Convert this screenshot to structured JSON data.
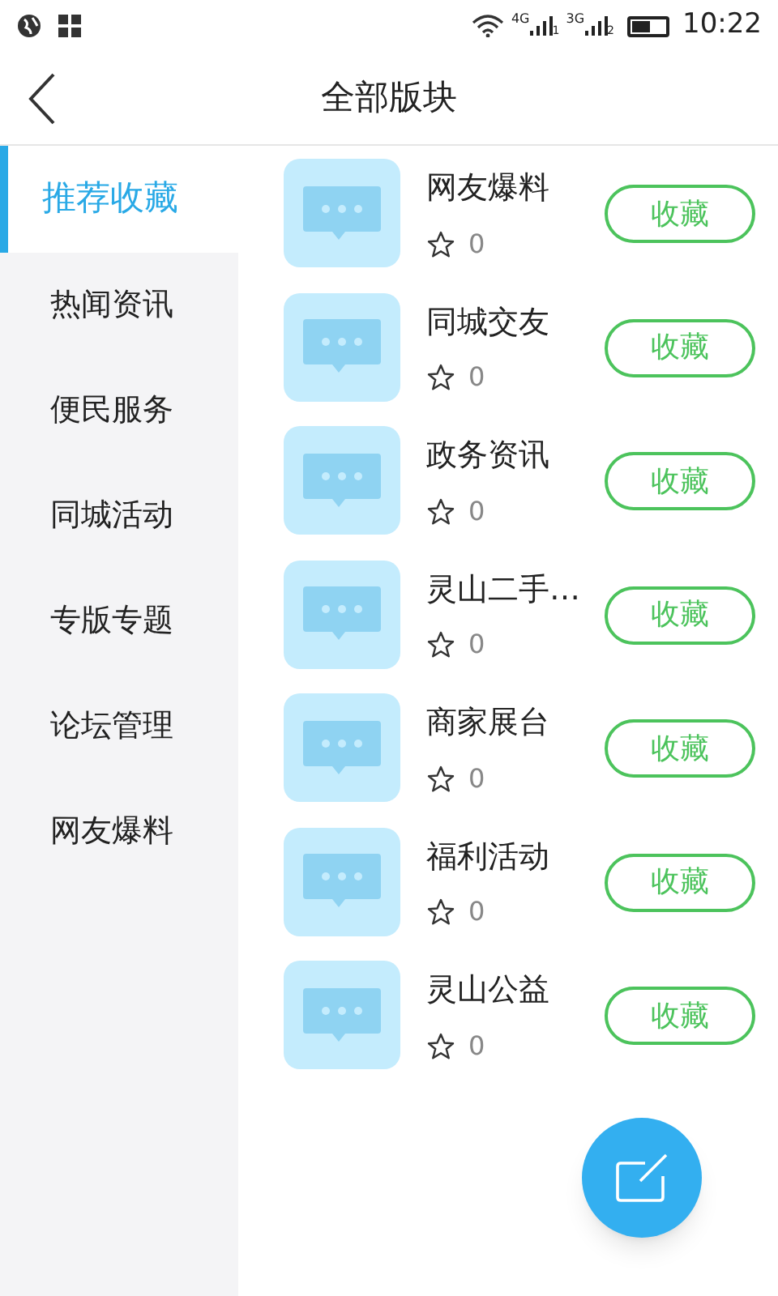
{
  "status_bar": {
    "network_1": "4G",
    "sim_1": "1",
    "network_2": "3G",
    "sim_2": "2",
    "time": "10:22"
  },
  "header": {
    "title": "全部版块"
  },
  "sidebar": {
    "items": [
      {
        "label": "推荐收藏",
        "selected": true
      },
      {
        "label": "热闻资讯",
        "selected": false
      },
      {
        "label": "便民服务",
        "selected": false
      },
      {
        "label": "同城活动",
        "selected": false
      },
      {
        "label": "专版专题",
        "selected": false
      },
      {
        "label": "论坛管理",
        "selected": false
      },
      {
        "label": "网友爆料",
        "selected": false
      }
    ]
  },
  "forums": [
    {
      "name": "网友爆料",
      "count": "0",
      "button": "收藏"
    },
    {
      "name": "同城交友",
      "count": "0",
      "button": "收藏"
    },
    {
      "name": "政务资讯",
      "count": "0",
      "button": "收藏"
    },
    {
      "name": "灵山二手…",
      "count": "0",
      "button": "收藏"
    },
    {
      "name": "商家展台",
      "count": "0",
      "button": "收藏"
    },
    {
      "name": "福利活动",
      "count": "0",
      "button": "收藏"
    },
    {
      "name": "灵山公益",
      "count": "0",
      "button": "收藏"
    }
  ]
}
